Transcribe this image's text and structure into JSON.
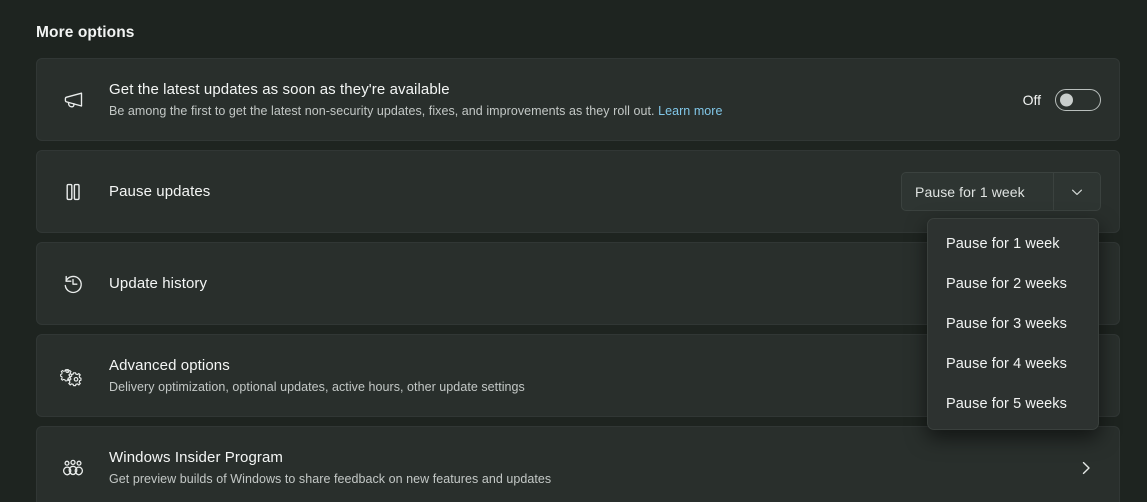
{
  "section": {
    "heading": "More options"
  },
  "cards": [
    {
      "icon": "megaphone-icon",
      "title": "Get the latest updates as soon as they're available",
      "subtitle": "Be among the first to get the latest non-security updates, fixes, and improvements as they roll out.",
      "link_label": "Learn more",
      "toggle": {
        "label": "Off",
        "state": "off"
      }
    },
    {
      "icon": "pause-icon",
      "title": "Pause updates",
      "subtitle": "",
      "link_label": "",
      "toggle": null
    },
    {
      "icon": "update-history-icon",
      "title": "Update history",
      "subtitle": "",
      "link_label": "",
      "toggle": null
    },
    {
      "icon": "gears-icon",
      "title": "Advanced options",
      "subtitle": "Delivery optimization, optional updates, active hours, other update settings",
      "link_label": "",
      "toggle": null
    },
    {
      "icon": "people-icon",
      "title": "Windows Insider Program",
      "subtitle": "Get preview builds of Windows to share feedback on new features and updates",
      "link_label": "",
      "toggle": null
    }
  ],
  "combo": {
    "selected": "Pause for 1 week",
    "arrow_icon": "chevron-down-icon"
  },
  "dropdown": {
    "open": true,
    "items": [
      "Pause for 1 week",
      "Pause for 2 weeks",
      "Pause for 3 weeks",
      "Pause for 4 weeks",
      "Pause for 5 weeks"
    ]
  },
  "colors": {
    "page_background": "#1e2420",
    "card_background": "#292f2c",
    "accent_link": "#81c7e8",
    "text_primary": "#f4f6f5",
    "text_secondary": "#c3c8c6",
    "dropdown_background": "#2d3230"
  }
}
